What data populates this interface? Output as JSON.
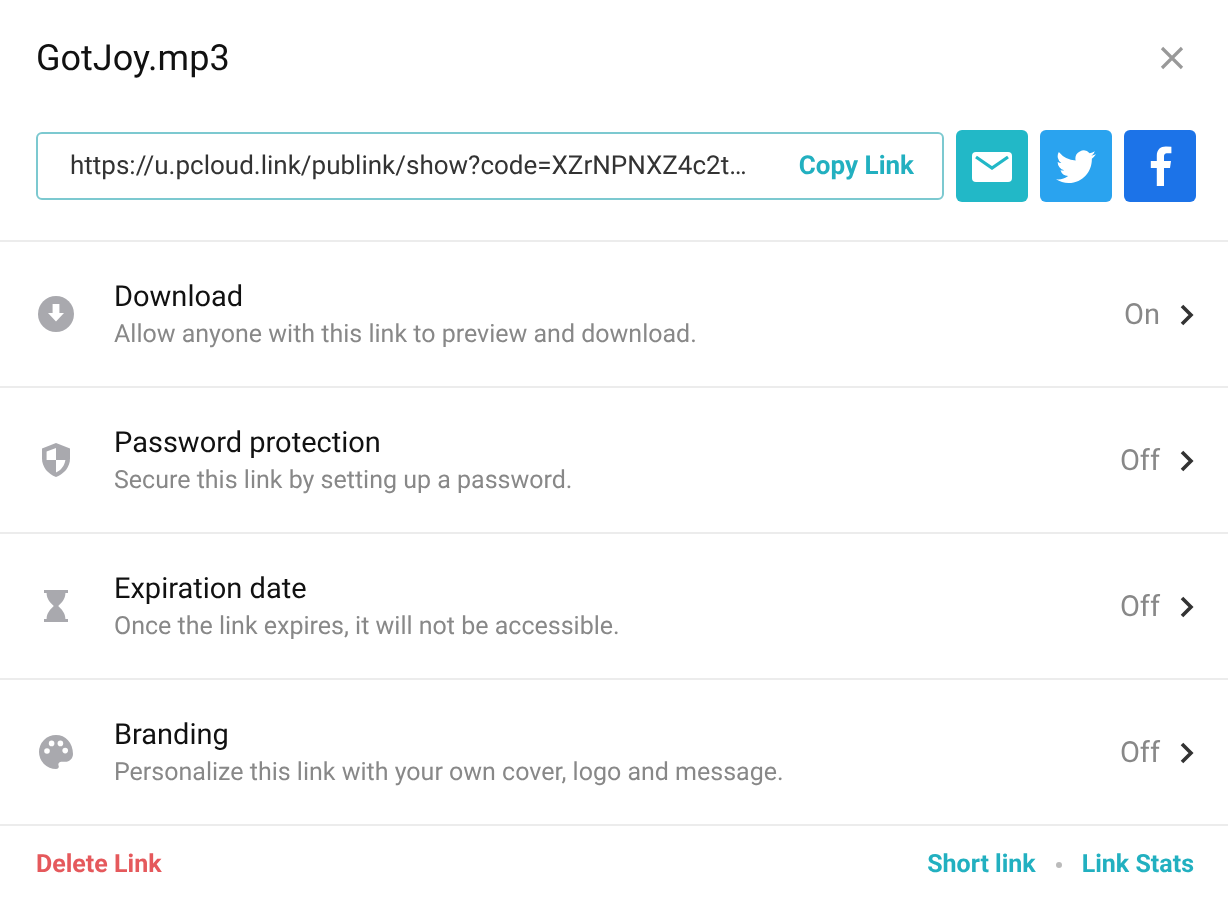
{
  "dialog": {
    "title": "GotJoy.mp3"
  },
  "link": {
    "value": "https://u.pcloud.link/publink/show?code=XZrNPNXZ4c2t…",
    "copy": "Copy Link"
  },
  "share_buttons": [
    {
      "kind": "mail"
    },
    {
      "kind": "twitter"
    },
    {
      "kind": "facebook"
    }
  ],
  "settings": [
    {
      "kind": "download",
      "title": "Download",
      "description": "Allow anyone with this link to preview and download.",
      "status": "On"
    },
    {
      "kind": "password",
      "title": "Password protection",
      "description": "Secure this link by setting up a password.",
      "status": "Off"
    },
    {
      "kind": "expiration",
      "title": "Expiration date",
      "description": "Once the link expires, it will not be accessible.",
      "status": "Off"
    },
    {
      "kind": "branding",
      "title": "Branding",
      "description": "Personalize this link with your own cover, logo and message.",
      "status": "Off"
    }
  ],
  "footer": {
    "delete": "Delete Link",
    "links": [
      "Short link",
      "Link Stats"
    ]
  }
}
